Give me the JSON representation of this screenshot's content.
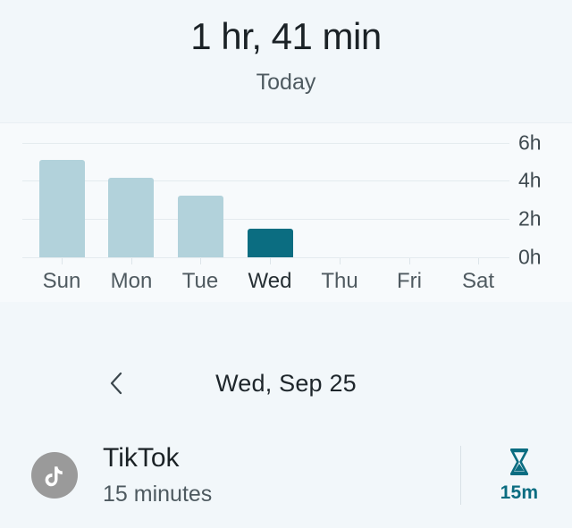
{
  "header": {
    "total_time": "1 hr, 41 min",
    "period_label": "Today"
  },
  "chart_data": {
    "type": "bar",
    "title": "",
    "xlabel": "",
    "ylabel": "",
    "categories": [
      "Sun",
      "Mon",
      "Tue",
      "Wed",
      "Thu",
      "Fri",
      "Sat"
    ],
    "values": [
      5.1,
      4.15,
      3.2,
      1.5,
      0,
      0,
      0
    ],
    "unit": "hours",
    "ylim": [
      0,
      6.65
    ],
    "yticks": [
      0,
      2,
      4,
      6
    ],
    "ytick_labels": [
      "0h",
      "2h",
      "4h",
      "6h"
    ],
    "grid": true,
    "legend": "none",
    "selected_index": 3,
    "bar_color": "#b2d2db",
    "selected_bar_color": "#0b6d81"
  },
  "date_nav": {
    "prev_icon": "chevron-left-icon",
    "date_label": "Wed, Sep 25"
  },
  "app_row": {
    "icon": "tiktok-icon",
    "name": "TikTok",
    "duration": "15 minutes",
    "timer_icon": "hourglass-icon",
    "timer_label": "15m",
    "accent_color": "#0b6d81"
  }
}
